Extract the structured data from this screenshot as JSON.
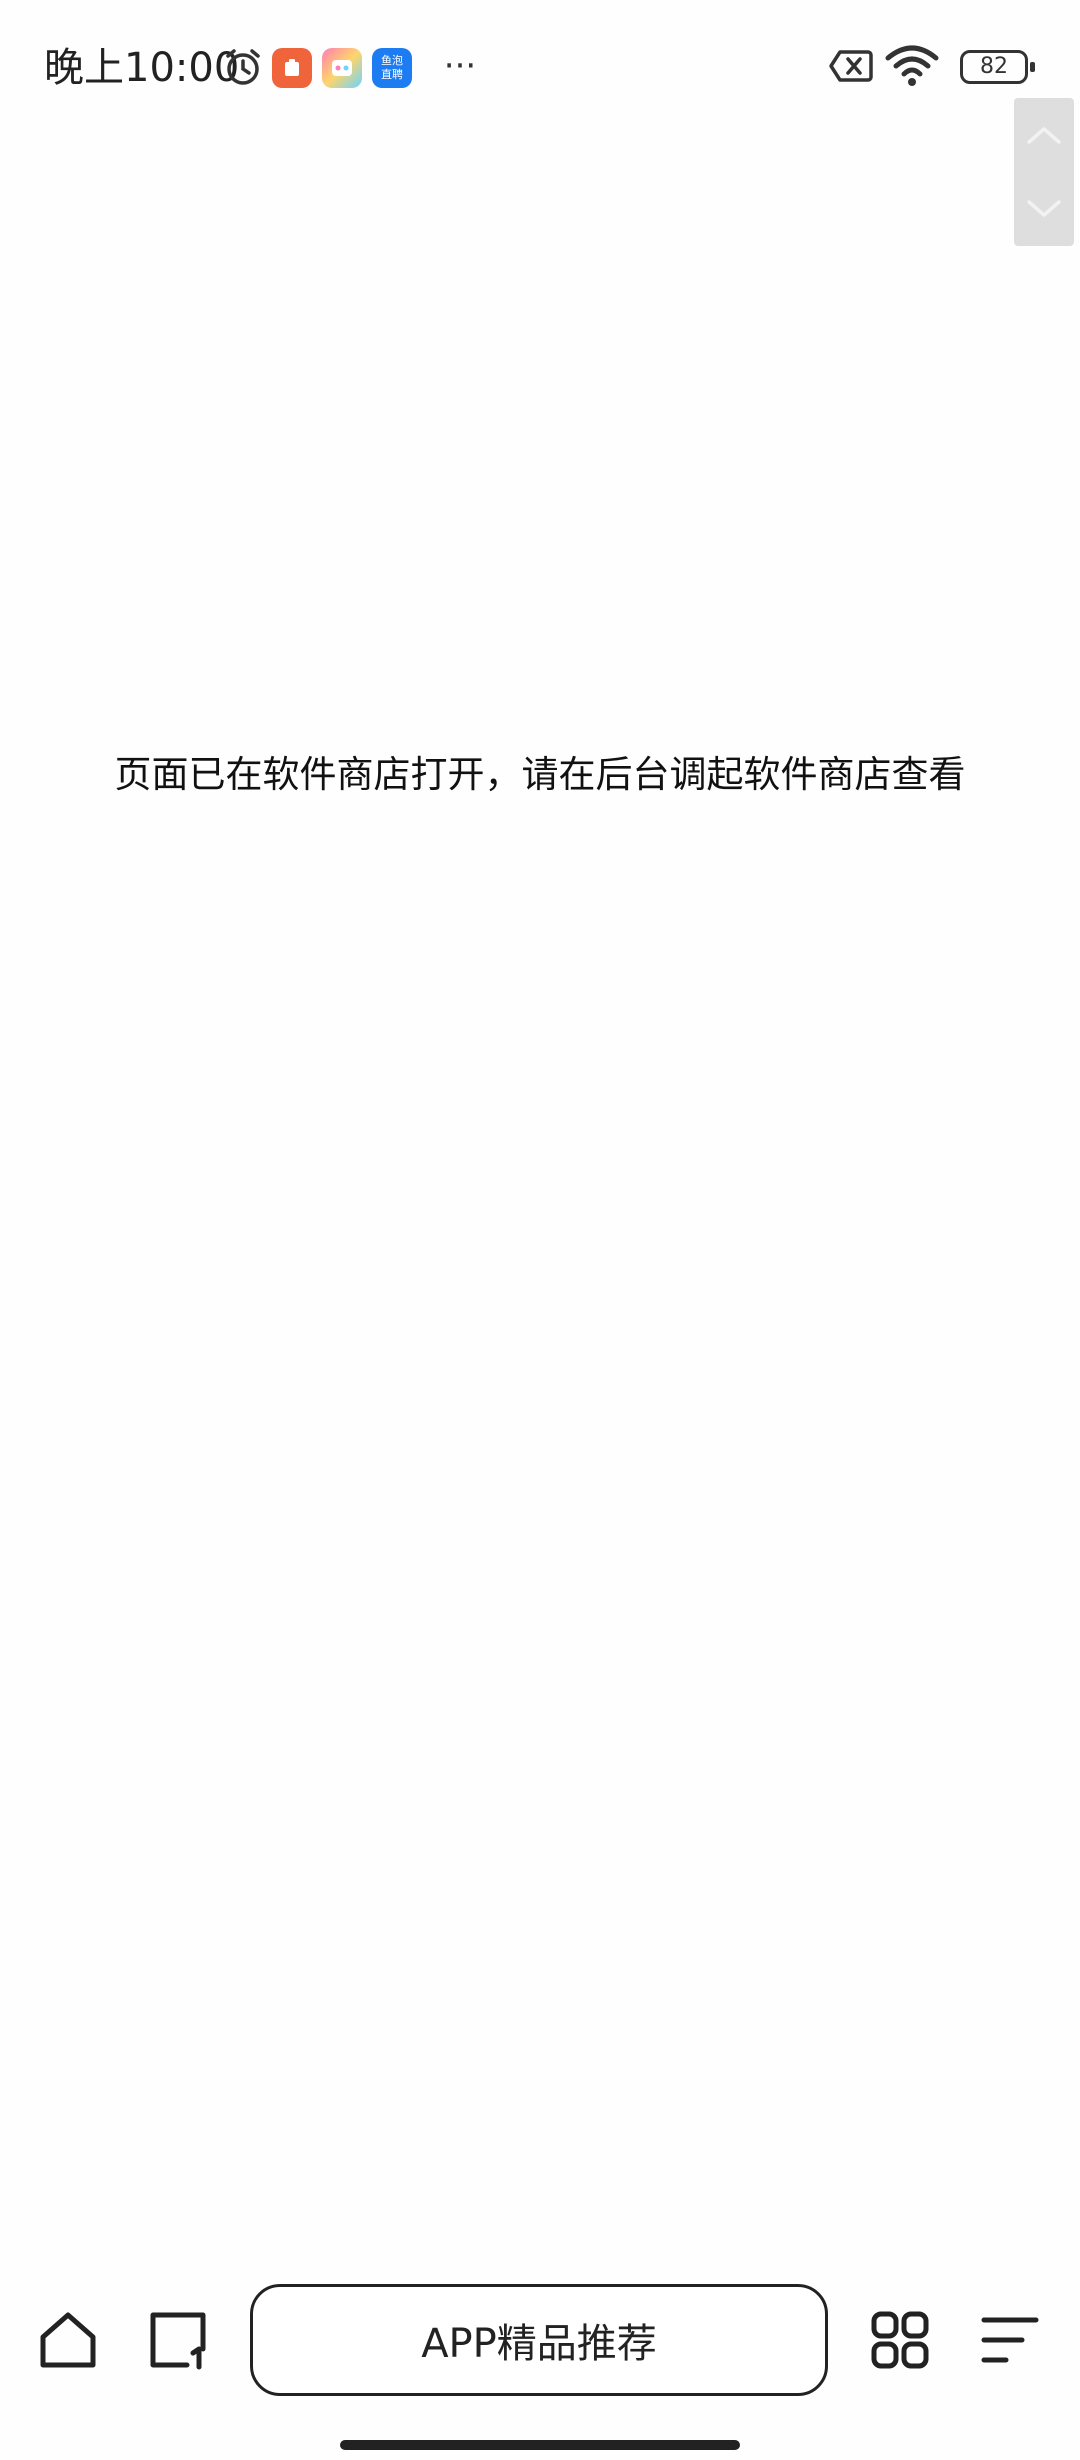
{
  "status_bar": {
    "time": "晚上10:00",
    "battery": "82",
    "icons": [
      "alarm-icon",
      "app-red-icon",
      "app-game-icon",
      "app-fish-live-icon",
      "more-dots-icon",
      "sim-x-icon",
      "wifi-icon",
      "battery-icon"
    ],
    "fish_live_badge": "鱼泡\n直聘",
    "more": "···"
  },
  "scroll_control": {
    "up": "scroll-up",
    "down": "scroll-down"
  },
  "main": {
    "message": "页面已在软件商店打开，请在后台调起软件商店查看"
  },
  "bottom_bar": {
    "recommend_label": "APP精品推荐",
    "icons": [
      "home-icon",
      "tabs-icon",
      "apps-grid-icon",
      "menu-icon"
    ]
  },
  "colors": {
    "background": "#fefefe",
    "text": "#111111",
    "scroll_bg": "#dedede",
    "app_red": "#f0643c",
    "fish_blue": "#1e7cf2"
  }
}
